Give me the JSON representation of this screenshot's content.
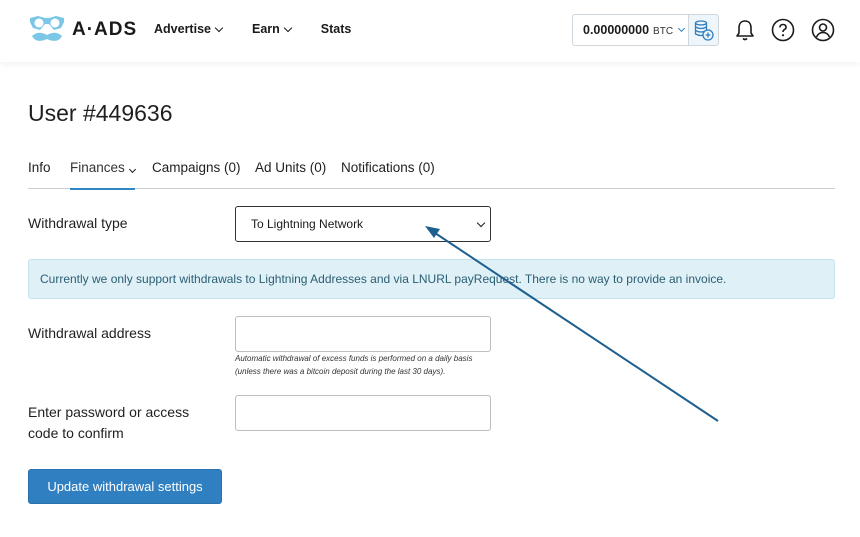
{
  "header": {
    "logo_text": "A·ADS",
    "nav": [
      {
        "label": "Advertise",
        "has_dropdown": true
      },
      {
        "label": "Earn",
        "has_dropdown": true
      },
      {
        "label": "Stats",
        "has_dropdown": false
      }
    ],
    "balance": {
      "amount": "0.00000000",
      "currency": "BTC"
    },
    "icons": [
      "wallet-add-icon",
      "bell-icon",
      "help-icon",
      "user-icon"
    ]
  },
  "page": {
    "title": "User #449636",
    "tabs": [
      {
        "label": "Info",
        "active": false
      },
      {
        "label": "Finances",
        "active": true,
        "has_dropdown": true
      },
      {
        "label": "Campaigns (0)",
        "active": false
      },
      {
        "label": "Ad Units (0)",
        "active": false
      },
      {
        "label": "Notifications (0)",
        "active": false
      }
    ]
  },
  "form": {
    "withdrawal_type_label": "Withdrawal type",
    "withdrawal_type_value": "To Lightning Network",
    "info_message": "Currently we only support withdrawals to Lightning Addresses and via LNURL payRequest. There is no way to provide an invoice.",
    "address_label": "Withdrawal address",
    "address_value": "",
    "address_help_line1": "Automatic withdrawal of excess funds is performed on a daily basis",
    "address_help_line2": "(unless there was a bitcoin deposit during the last 30 days).",
    "password_label_line1": "Enter password or access",
    "password_label_line2": "code to confirm",
    "password_value": "",
    "submit_label": "Update withdrawal settings"
  },
  "colors": {
    "accent": "#2f7fc1",
    "tab_underline": "#2f87c6",
    "info_bg": "#dff0f7",
    "info_text": "#2b5f73",
    "annotation_arrow": "#1d5f8f"
  }
}
